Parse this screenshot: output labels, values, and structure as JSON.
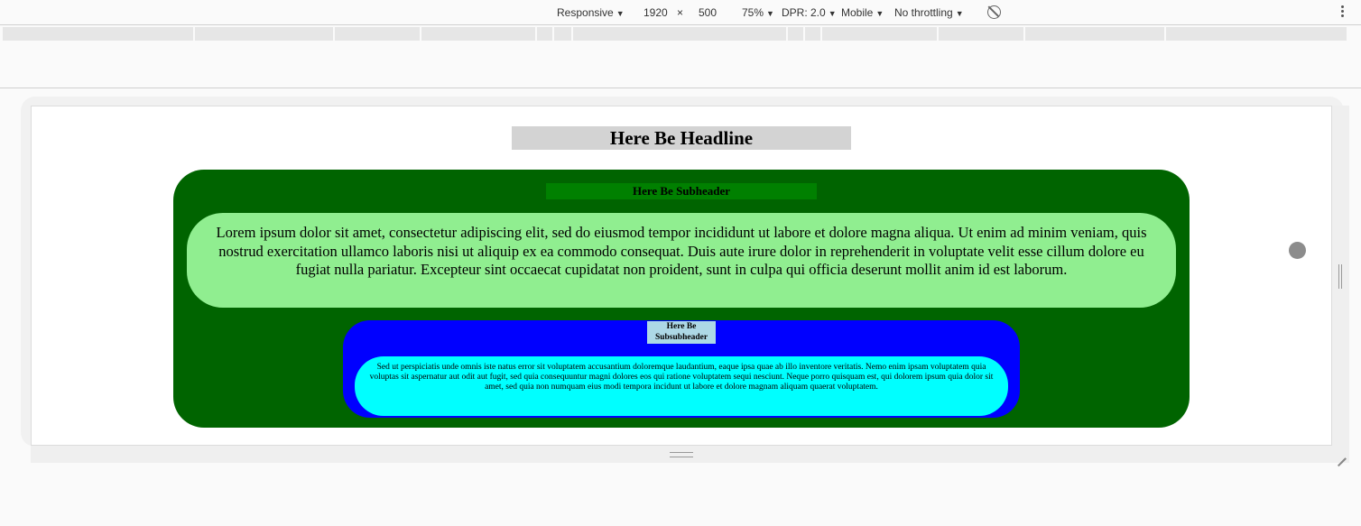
{
  "devtools": {
    "device_mode": "Responsive",
    "width": "1920",
    "times": "×",
    "height": "500",
    "zoom": "75%",
    "dpr": "DPR: 2.0",
    "device_type": "Mobile",
    "throttling": "No throttling",
    "caret": "▼"
  },
  "page": {
    "headline": "Here Be Headline",
    "subheader": "Here Be Subheader",
    "paragraph": "Lorem ipsum dolor sit amet, consectetur adipiscing elit, sed do eiusmod tempor incididunt ut labore et dolore magna aliqua. Ut enim ad minim veniam, quis nostrud exercitation ullamco laboris nisi ut aliquip ex ea commodo consequat. Duis aute irure dolor in reprehenderit in voluptate velit esse cillum dolore eu fugiat nulla pariatur. Excepteur sint occaecat cupidatat non proident, sunt in culpa qui officia deserunt mollit anim id est laborum.",
    "subsubheader": "Here Be Subsubheader",
    "small_paragraph": "Sed ut perspiciatis unde omnis iste natus error sit voluptatem accusantium doloremque laudantium, eaque ipsa quae ab illo inventore veritatis. Nemo enim ipsam voluptatem quia voluptas sit aspernatur aut odit aut fugit, sed quia consequuntur magni dolores eos qui ratione voluptatem sequi nesciunt. Neque porro quisquam est, qui dolorem ipsum quia dolor sit amet, sed quia non numquam eius modi tempora incidunt ut labore et dolore magnam aliquam quaerat voluptatem."
  },
  "colors": {
    "headline_bg": "#d3d3d3",
    "outer_box": "#006400",
    "subheader_bg": "#008000",
    "lorem_box": "#90ee90",
    "blue_box": "#0000ff",
    "subsub_bg": "#add8e6",
    "cyan_box": "#00ffff"
  },
  "icons": {
    "rotate": "rotate-icon",
    "more": "more-vertical-icon"
  }
}
